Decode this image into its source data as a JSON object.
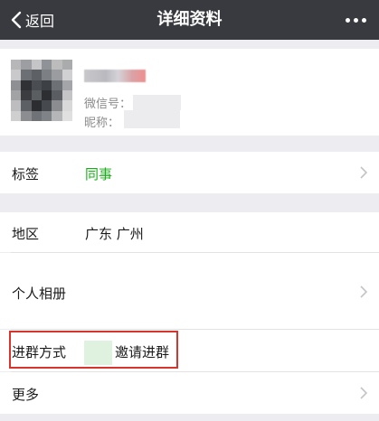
{
  "navbar": {
    "back_label": "返回",
    "title": "详细资料",
    "more_icon": "more-icon"
  },
  "profile": {
    "wechat_id_label": "微信号：",
    "nickname_label": "昵称："
  },
  "rows": {
    "tag": {
      "label": "标签",
      "value": "同事",
      "value_color": "#1aad19"
    },
    "region": {
      "label": "地区",
      "value": "广东 广州"
    },
    "album": {
      "label": "个人相册"
    },
    "join_method": {
      "label": "进群方式",
      "value": "邀请进群"
    },
    "more": {
      "label": "更多"
    }
  },
  "colors": {
    "navbar_bg": "#393a3f",
    "page_bg": "#ececf1",
    "highlight": "#d9332d"
  }
}
